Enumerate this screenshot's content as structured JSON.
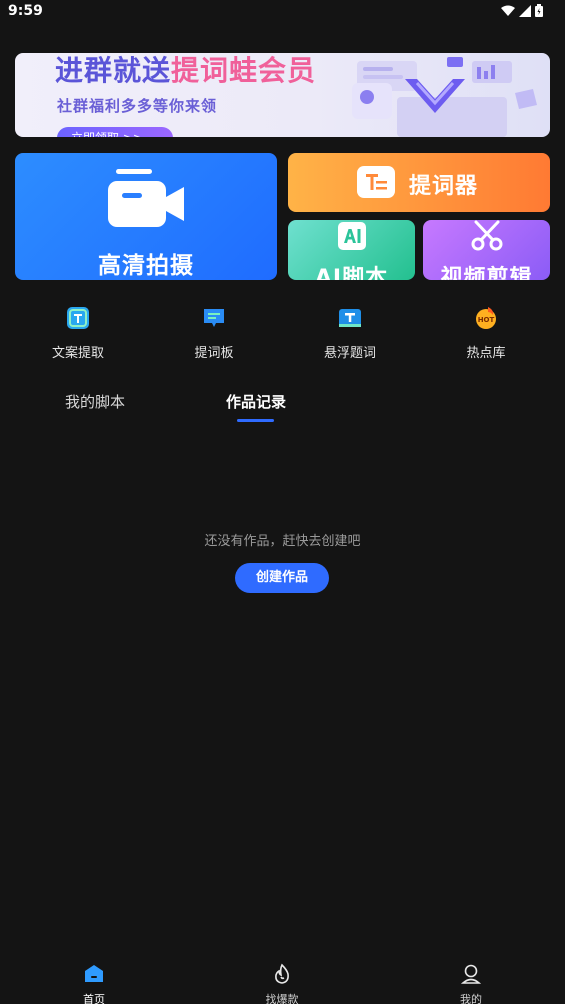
{
  "status_bar": {
    "time": "9:59"
  },
  "banner": {
    "title_part1": "进群就送",
    "title_part2": "提词蛙会员",
    "subtitle": "社群福利多多等你来领",
    "button_label": "立即领取 >>"
  },
  "cards": {
    "shoot": "高清拍摄",
    "prompter": "提词器",
    "ai_script": "AI脚本",
    "video_edit": "视频剪辑"
  },
  "tools": [
    {
      "label": "文案提取",
      "icon": "text-extract-icon"
    },
    {
      "label": "提词板",
      "icon": "prompt-board-icon"
    },
    {
      "label": "悬浮题词",
      "icon": "floating-prompt-icon"
    },
    {
      "label": "热点库",
      "icon": "hot-topics-icon",
      "badge": "HOT"
    }
  ],
  "tabs": [
    {
      "label": "我的脚本",
      "active": false
    },
    {
      "label": "作品记录",
      "active": true
    }
  ],
  "empty_state": {
    "message": "还没有作品，赶快去创建吧",
    "button_label": "创建作品"
  },
  "bottom_nav": [
    {
      "label": "首页",
      "icon": "home-icon",
      "active": true
    },
    {
      "label": "找爆款",
      "icon": "fire-icon",
      "active": false
    },
    {
      "label": "我的",
      "icon": "profile-icon",
      "active": false
    }
  ],
  "colors": {
    "background": "#141414",
    "accent": "#2f6bff",
    "shoot_card": "#2d8dff",
    "prompter_card": "#ff7a33",
    "ai_card": "#23c08f",
    "edit_card": "#8b5cf6"
  }
}
